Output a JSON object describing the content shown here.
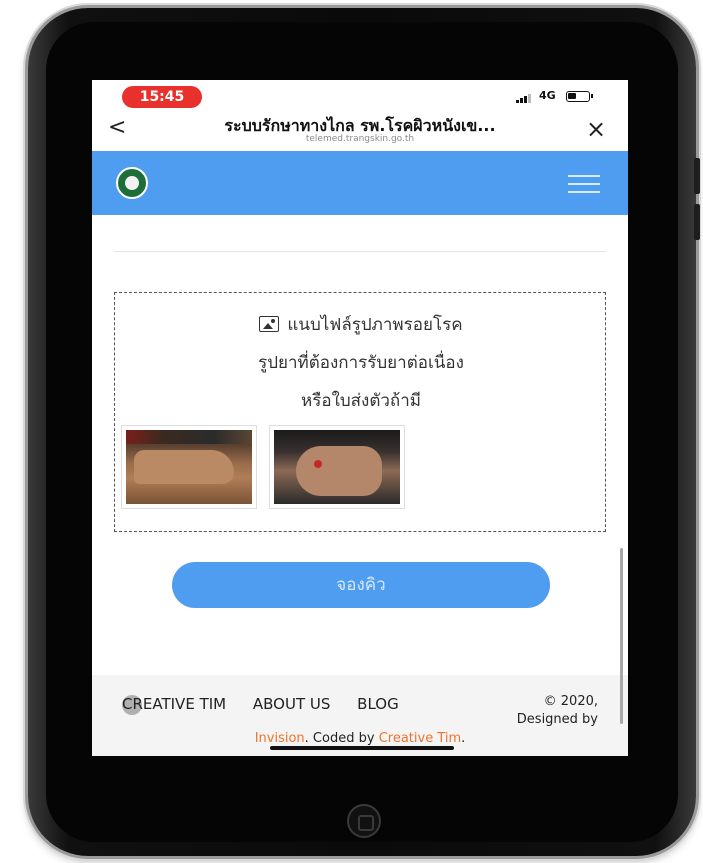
{
  "status_bar": {
    "time": "15:45",
    "network": "4G"
  },
  "browser": {
    "back_label": "<",
    "title": "ระบบรักษาทางไกล รพ.โรคผิวหนังเข...",
    "url": "telemed.trangskin.go.th",
    "close_label": "×"
  },
  "app_header": {
    "logo_icon": "ministry-logo-icon",
    "menu_icon": "hamburger-menu-icon"
  },
  "upload": {
    "icon": "image-icon",
    "line1": "แนบไฟล์รูปภาพรอยโรค",
    "line2": "รูปยาที่ต้องการรับยาต่อเนื่อง",
    "line3": "หรือใบส่งตัวถ้ามี"
  },
  "submit_button": {
    "label": "จองคิว"
  },
  "footer": {
    "links": [
      "CREATIVE TIM",
      "ABOUT US",
      "BLOG"
    ],
    "copyright_line1": "© 2020,",
    "copyright_line2": "Designed by",
    "credit_link1": "Invision",
    "credit_mid": ". Coded by ",
    "credit_link2": "Creative Tim",
    "credit_end": "."
  },
  "colors": {
    "accent": "#4f9df0",
    "time_pill": "#e8312d",
    "link": "#f0732b"
  }
}
